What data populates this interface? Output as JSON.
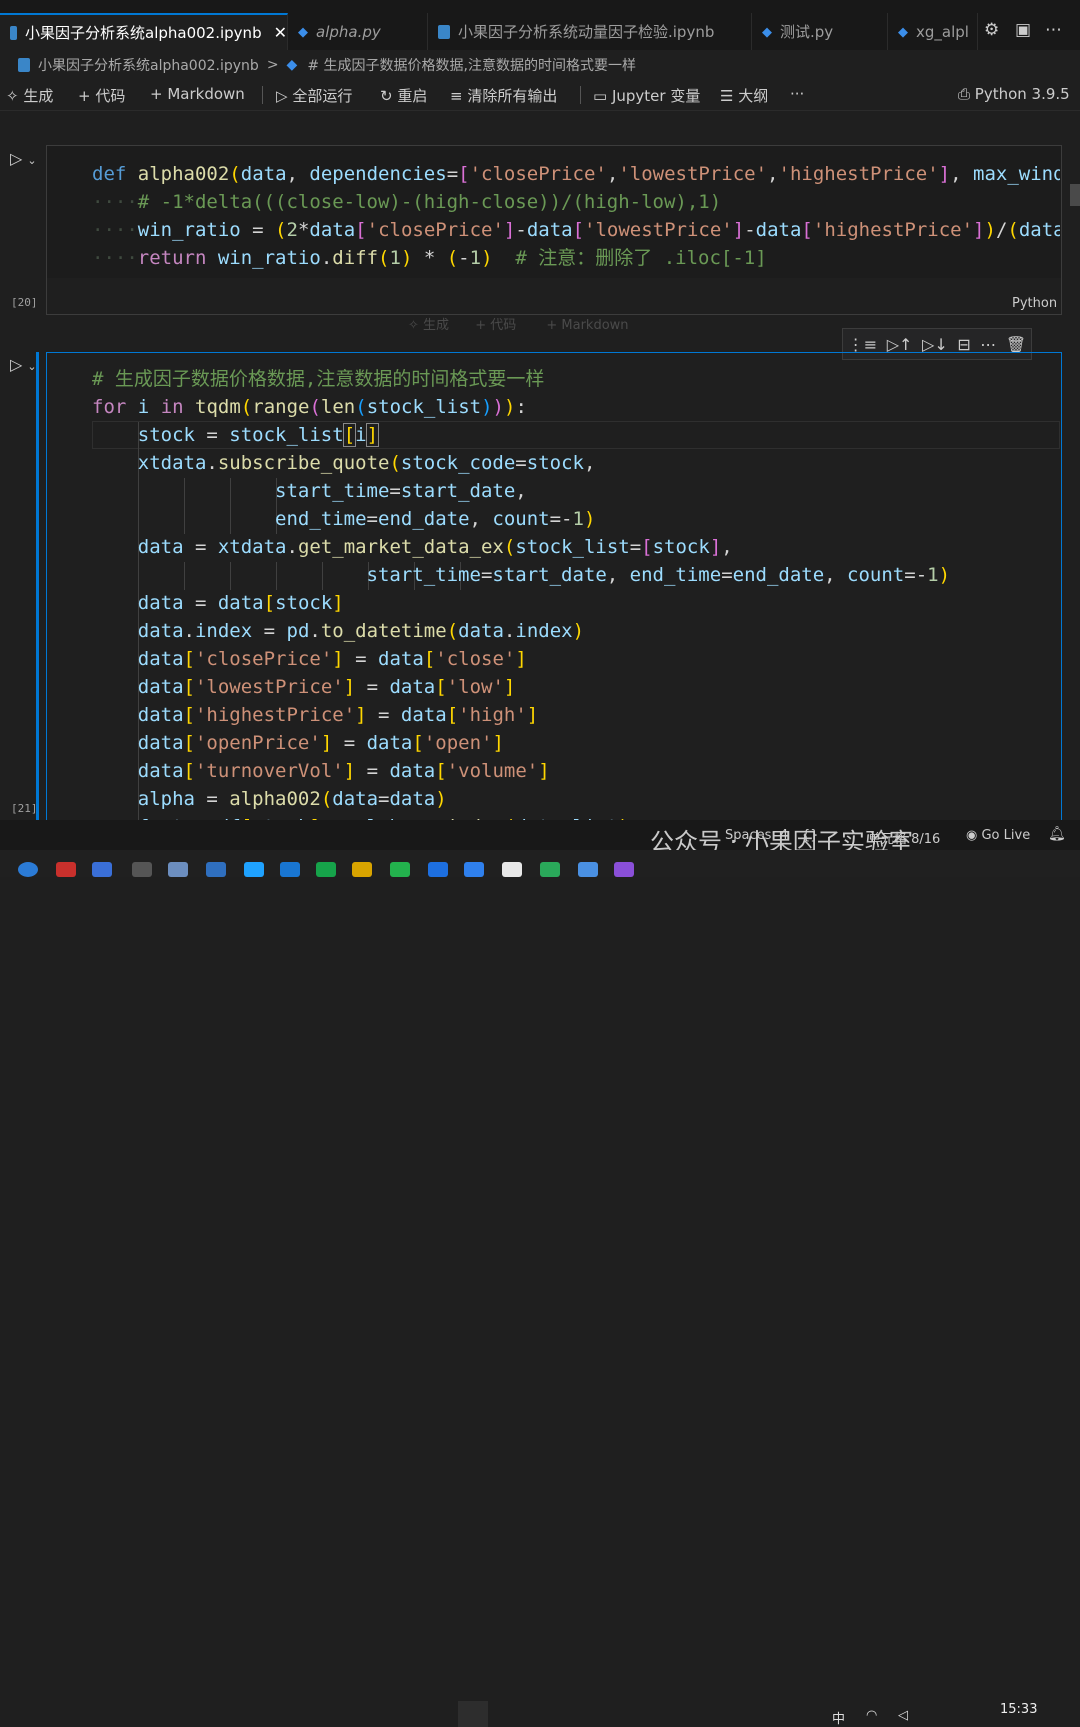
{
  "tabs": [
    {
      "label": "小果因子分析系统alpha002.ipynb",
      "type": "notebook",
      "active": true,
      "close": "✕"
    },
    {
      "label": "alpha.py",
      "type": "python",
      "active": false
    },
    {
      "label": "小果因子分析系统动量因子检验.ipynb",
      "type": "notebook",
      "active": false
    },
    {
      "label": "测试.py",
      "type": "python",
      "active": false
    },
    {
      "label": "xg_alpl",
      "type": "python",
      "active": false
    }
  ],
  "breadcrumb": {
    "file": "小果因子分析系统alpha002.ipynb",
    "sep": ">",
    "section": "# 生成因子数据价格数据,注意数据的时间格式要一样"
  },
  "toolbar": {
    "generate": "生成",
    "add_code": "+ 代码",
    "add_markdown": "+ Markdown",
    "run_all": "全部运行",
    "restart": "重启",
    "clear_outputs": "清除所有输出",
    "jupyter_vars": "Jupyter 变量",
    "outline": "大纲",
    "more": "···",
    "kernel": "Python 3.9.5"
  },
  "cells": [
    {
      "exec_count": "[20]",
      "language": "Python"
    },
    {
      "exec_count": "[21]"
    }
  ],
  "hover_insert": {
    "generate": "生成",
    "code": "+ 代码",
    "markdown": "+ Markdown"
  },
  "status": {
    "spaces": "Spaces: 4",
    "braces": "{}",
    "cell": "单元格 8/16",
    "golive": "Go Live",
    "watermark": "公众号 · 小果因子实验室"
  },
  "clock": "15:33",
  "colors": {
    "accent": "#0078d4",
    "background": "#1f1f1f",
    "keyword": "#569cd6",
    "string": "#ce9178",
    "comment": "#6a9955"
  }
}
